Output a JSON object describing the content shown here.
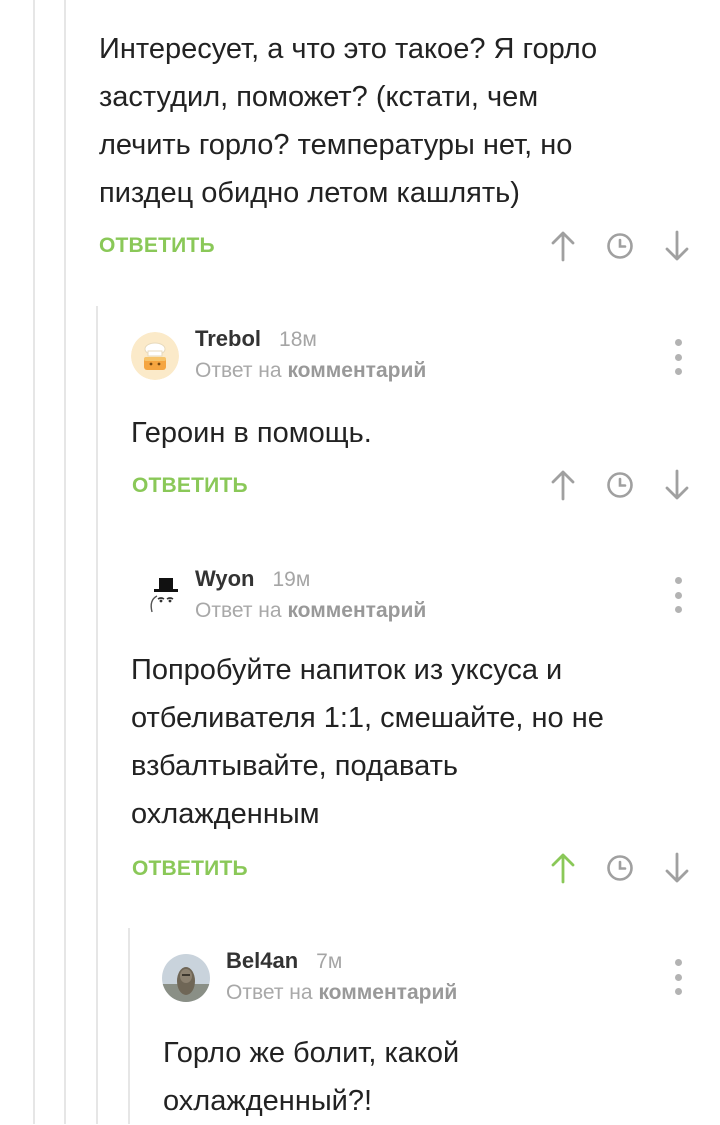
{
  "colors": {
    "accent_green": "#8ac858",
    "icon_gray": "#a0a0a0",
    "text": "#222222",
    "meta_gray": "#a8a8a8",
    "thread_line": "#e6e6e6"
  },
  "icons": {
    "upvote": "up-arrow-icon",
    "history": "clock-icon",
    "downvote": "down-arrow-icon",
    "more": "vertical-dots-icon"
  },
  "comments": [
    {
      "text_lines": [
        "Интересует, а что это такое? Я горло",
        "застудил, поможет? (кстати, чем",
        "лечить горло? температуры нет, но",
        "пиздец обидно летом кашлять)"
      ],
      "reply_label": "ОТВЕТИТЬ",
      "upvoted": false
    },
    {
      "username": "Trebol",
      "time": "18м",
      "reply_to_prefix": "Ответ на",
      "reply_to_link": "комментарий",
      "avatar": "chef-cake-avatar",
      "text_lines": [
        "Героин в помощь."
      ],
      "reply_label": "ОТВЕТИТЬ",
      "upvoted": false
    },
    {
      "username": "Wyon",
      "time": "19м",
      "reply_to_prefix": "Ответ на",
      "reply_to_link": "комментарий",
      "avatar": "top-hat-face-avatar",
      "text_lines": [
        "Попробуйте напиток из уксуса и",
        "отбеливателя 1:1, смешайте, но не",
        "взбалтывайте, подавать",
        "охлажденным"
      ],
      "reply_label": "ОТВЕТИТЬ",
      "upvoted": true
    },
    {
      "username": "Bel4an",
      "time": "7м",
      "reply_to_prefix": "Ответ на",
      "reply_to_link": "комментарий",
      "avatar": "photo-avatar",
      "text_lines": [
        "Горло же болит, какой",
        "охлажденный?!"
      ]
    }
  ]
}
